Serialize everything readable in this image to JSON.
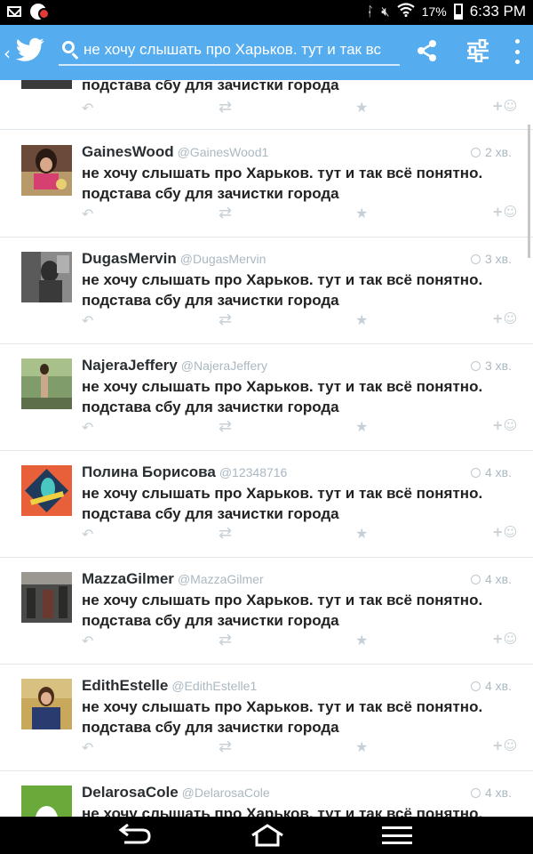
{
  "status_bar": {
    "battery_percent": "17%",
    "time": "6:33 PM",
    "icons": [
      "mail-icon",
      "notification-icon",
      "bluetooth-icon",
      "volume-muted-icon",
      "wifi-icon",
      "battery-icon"
    ]
  },
  "app_bar": {
    "brand_color": "#55acee",
    "search_query": "не хочу слышать про Харьков. тут и так вс",
    "icons": [
      "back-chevron-icon",
      "twitter-bird-icon",
      "search-icon",
      "share-icon",
      "filter-icon",
      "overflow-menu-icon"
    ]
  },
  "timeline": {
    "partial_top_text": "подстава сбу для зачистки города",
    "tweets": [
      {
        "name": "GainesWood",
        "handle": "@GainesWood1",
        "time": "2 хв.",
        "line1": "не хочу слышать про Харьков. тут и так всё понятно.",
        "line2": "подстава сбу для зачистки города"
      },
      {
        "name": "DugasMervin",
        "handle": "@DugasMervin",
        "time": "3 хв.",
        "line1": "не хочу слышать про Харьков. тут и так всё понятно.",
        "line2": "подстава сбу для зачистки города"
      },
      {
        "name": "NajeraJeffery",
        "handle": "@NajeraJeffery",
        "time": "3 хв.",
        "line1": "не хочу слышать про Харьков. тут и так всё понятно.",
        "line2": "подстава сбу для зачистки города"
      },
      {
        "name": "Полина Борисова",
        "handle": "@12348716",
        "time": "4 хв.",
        "line1": "не хочу слышать про Харьков. тут и так всё понятно.",
        "line2": "подстава сбу для зачистки города"
      },
      {
        "name": "MazzaGilmer",
        "handle": "@MazzaGilmer",
        "time": "4 хв.",
        "line1": "не хочу слышать про Харьков. тут и так всё понятно.",
        "line2": "подстава сбу для зачистки города"
      },
      {
        "name": "EdithEstelle",
        "handle": "@EdithEstelle1",
        "time": "4 хв.",
        "line1": "не хочу слышать про Харьков. тут и так всё понятно.",
        "line2": "подстава сбу для зачистки города"
      },
      {
        "name": "DelarosaCole",
        "handle": "@DelarosaCole",
        "time": "4 хв.",
        "line1": "не хочу слышать про Харьков. тут и так всё понятно.",
        "line2": ""
      }
    ],
    "action_icons": [
      "reply-icon",
      "retweet-icon",
      "favorite-star-icon",
      "follow-icon"
    ]
  },
  "nav_bar": {
    "icons": [
      "nav-back-icon",
      "nav-home-icon",
      "nav-menu-icon"
    ]
  }
}
